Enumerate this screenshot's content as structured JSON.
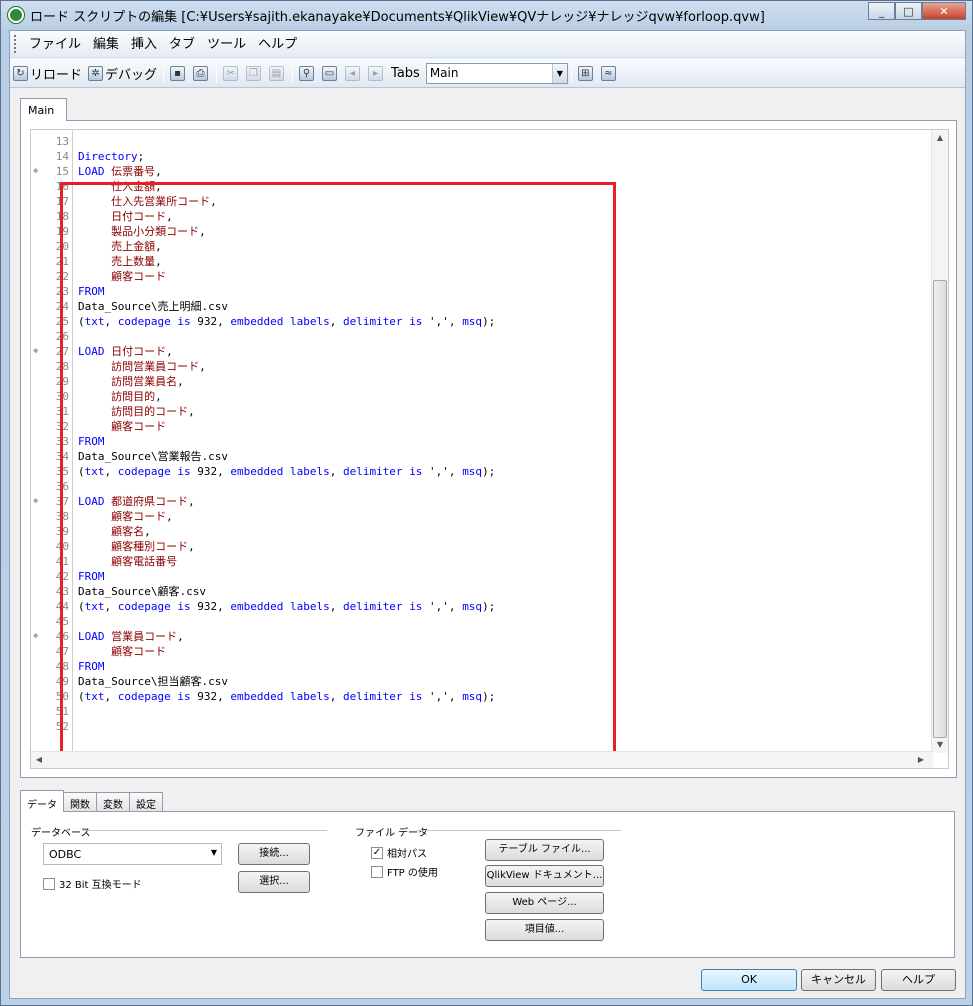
{
  "window": {
    "title": "ロード スクリプトの編集 [C:¥Users¥sajith.ekanayake¥Documents¥QlikView¥QVナレッジ¥ナレッジqvw¥forloop.qvw]",
    "min": "_",
    "max": "□",
    "close": "✕"
  },
  "menu": [
    "ファイル",
    "編集",
    "挿入",
    "タブ",
    "ツール",
    "ヘルプ"
  ],
  "toolbar": {
    "reload": "リロード",
    "debug": "デバッグ",
    "tabs_label": "Tabs",
    "tabs_value": "Main"
  },
  "editor_tab": "Main",
  "code": [
    {
      "n": "13",
      "t": []
    },
    {
      "n": "14",
      "t": [
        [
          "kw",
          "Directory"
        ],
        [
          "plain",
          ";"
        ]
      ]
    },
    {
      "n": "15",
      "t": [
        [
          "kw",
          "LOAD "
        ],
        [
          "fld",
          "伝票番号"
        ],
        [
          "plain",
          ","
        ]
      ]
    },
    {
      "n": "16",
      "t": [
        [
          "plain",
          "     "
        ],
        [
          "fld",
          "仕入金額"
        ],
        [
          "plain",
          ","
        ]
      ]
    },
    {
      "n": "17",
      "t": [
        [
          "plain",
          "     "
        ],
        [
          "fld",
          "仕入先営業所コード"
        ],
        [
          "plain",
          ","
        ]
      ]
    },
    {
      "n": "18",
      "t": [
        [
          "plain",
          "     "
        ],
        [
          "fld",
          "日付コード"
        ],
        [
          "plain",
          ","
        ]
      ]
    },
    {
      "n": "19",
      "t": [
        [
          "plain",
          "     "
        ],
        [
          "fld",
          "製品小分類コード"
        ],
        [
          "plain",
          ","
        ]
      ]
    },
    {
      "n": "20",
      "t": [
        [
          "plain",
          "     "
        ],
        [
          "fld",
          "売上金額"
        ],
        [
          "plain",
          ","
        ]
      ]
    },
    {
      "n": "21",
      "t": [
        [
          "plain",
          "     "
        ],
        [
          "fld",
          "売上数量"
        ],
        [
          "plain",
          ","
        ]
      ]
    },
    {
      "n": "22",
      "t": [
        [
          "plain",
          "     "
        ],
        [
          "fld",
          "顧客コード"
        ]
      ]
    },
    {
      "n": "23",
      "t": [
        [
          "kw",
          "FROM"
        ]
      ]
    },
    {
      "n": "24",
      "t": [
        [
          "plain",
          "Data_Source\\売上明細.csv"
        ]
      ]
    },
    {
      "n": "25",
      "t": [
        [
          "plain",
          "("
        ],
        [
          "kw",
          "txt"
        ],
        [
          "plain",
          ", "
        ],
        [
          "kw",
          "codepage"
        ],
        [
          "plain",
          " "
        ],
        [
          "kw",
          "is"
        ],
        [
          "plain",
          " 932, "
        ],
        [
          "kw",
          "embedded labels"
        ],
        [
          "plain",
          ", "
        ],
        [
          "kw",
          "delimiter"
        ],
        [
          "plain",
          " "
        ],
        [
          "kw",
          "is"
        ],
        [
          "plain",
          " ',', "
        ],
        [
          "kw",
          "msq"
        ],
        [
          "plain",
          ");"
        ]
      ]
    },
    {
      "n": "26",
      "t": []
    },
    {
      "n": "27",
      "t": [
        [
          "kw",
          "LOAD "
        ],
        [
          "fld",
          "日付コード"
        ],
        [
          "plain",
          ","
        ]
      ]
    },
    {
      "n": "28",
      "t": [
        [
          "plain",
          "     "
        ],
        [
          "fld",
          "訪問営業員コード"
        ],
        [
          "plain",
          ","
        ]
      ]
    },
    {
      "n": "29",
      "t": [
        [
          "plain",
          "     "
        ],
        [
          "fld",
          "訪問営業員名"
        ],
        [
          "plain",
          ","
        ]
      ]
    },
    {
      "n": "30",
      "t": [
        [
          "plain",
          "     "
        ],
        [
          "fld",
          "訪問目的"
        ],
        [
          "plain",
          ","
        ]
      ]
    },
    {
      "n": "31",
      "t": [
        [
          "plain",
          "     "
        ],
        [
          "fld",
          "訪問目的コード"
        ],
        [
          "plain",
          ","
        ]
      ]
    },
    {
      "n": "32",
      "t": [
        [
          "plain",
          "     "
        ],
        [
          "fld",
          "顧客コード"
        ]
      ]
    },
    {
      "n": "33",
      "t": [
        [
          "kw",
          "FROM"
        ]
      ]
    },
    {
      "n": "34",
      "t": [
        [
          "plain",
          "Data_Source\\営業報告.csv"
        ]
      ]
    },
    {
      "n": "35",
      "t": [
        [
          "plain",
          "("
        ],
        [
          "kw",
          "txt"
        ],
        [
          "plain",
          ", "
        ],
        [
          "kw",
          "codepage"
        ],
        [
          "plain",
          " "
        ],
        [
          "kw",
          "is"
        ],
        [
          "plain",
          " 932, "
        ],
        [
          "kw",
          "embedded labels"
        ],
        [
          "plain",
          ", "
        ],
        [
          "kw",
          "delimiter"
        ],
        [
          "plain",
          " "
        ],
        [
          "kw",
          "is"
        ],
        [
          "plain",
          " ',', "
        ],
        [
          "kw",
          "msq"
        ],
        [
          "plain",
          ");"
        ]
      ]
    },
    {
      "n": "36",
      "t": []
    },
    {
      "n": "37",
      "t": [
        [
          "kw",
          "LOAD "
        ],
        [
          "fld",
          "都道府県コード"
        ],
        [
          "plain",
          ","
        ]
      ]
    },
    {
      "n": "38",
      "t": [
        [
          "plain",
          "     "
        ],
        [
          "fld",
          "顧客コード"
        ],
        [
          "plain",
          ","
        ]
      ]
    },
    {
      "n": "39",
      "t": [
        [
          "plain",
          "     "
        ],
        [
          "fld",
          "顧客名"
        ],
        [
          "plain",
          ","
        ]
      ]
    },
    {
      "n": "40",
      "t": [
        [
          "plain",
          "     "
        ],
        [
          "fld",
          "顧客種別コード"
        ],
        [
          "plain",
          ","
        ]
      ]
    },
    {
      "n": "41",
      "t": [
        [
          "plain",
          "     "
        ],
        [
          "fld",
          "顧客電話番号"
        ]
      ]
    },
    {
      "n": "42",
      "t": [
        [
          "kw",
          "FROM"
        ]
      ]
    },
    {
      "n": "43",
      "t": [
        [
          "plain",
          "Data_Source\\顧客.csv"
        ]
      ]
    },
    {
      "n": "44",
      "t": [
        [
          "plain",
          "("
        ],
        [
          "kw",
          "txt"
        ],
        [
          "plain",
          ", "
        ],
        [
          "kw",
          "codepage"
        ],
        [
          "plain",
          " "
        ],
        [
          "kw",
          "is"
        ],
        [
          "plain",
          " 932, "
        ],
        [
          "kw",
          "embedded labels"
        ],
        [
          "plain",
          ", "
        ],
        [
          "kw",
          "delimiter"
        ],
        [
          "plain",
          " "
        ],
        [
          "kw",
          "is"
        ],
        [
          "plain",
          " ',', "
        ],
        [
          "kw",
          "msq"
        ],
        [
          "plain",
          ");"
        ]
      ]
    },
    {
      "n": "45",
      "t": []
    },
    {
      "n": "46",
      "t": [
        [
          "kw",
          "LOAD "
        ],
        [
          "fld",
          "営業員コード"
        ],
        [
          "plain",
          ","
        ]
      ]
    },
    {
      "n": "47",
      "t": [
        [
          "plain",
          "     "
        ],
        [
          "fld",
          "顧客コード"
        ]
      ]
    },
    {
      "n": "48",
      "t": [
        [
          "kw",
          "FROM"
        ]
      ]
    },
    {
      "n": "49",
      "t": [
        [
          "plain",
          "Data_Source\\担当顧客.csv"
        ]
      ]
    },
    {
      "n": "50",
      "t": [
        [
          "plain",
          "("
        ],
        [
          "kw",
          "txt"
        ],
        [
          "plain",
          ", "
        ],
        [
          "kw",
          "codepage"
        ],
        [
          "plain",
          " "
        ],
        [
          "kw",
          "is"
        ],
        [
          "plain",
          " 932, "
        ],
        [
          "kw",
          "embedded labels"
        ],
        [
          "plain",
          ", "
        ],
        [
          "kw",
          "delimiter"
        ],
        [
          "plain",
          " "
        ],
        [
          "kw",
          "is"
        ],
        [
          "plain",
          " ',', "
        ],
        [
          "kw",
          "msq"
        ],
        [
          "plain",
          ");"
        ]
      ]
    },
    {
      "n": "51",
      "t": []
    },
    {
      "n": "52",
      "t": []
    }
  ],
  "lower_tabs": [
    "データ",
    "関数",
    "変数",
    "設定"
  ],
  "database": {
    "group": "データベース",
    "value": "ODBC",
    "connect": "接続...",
    "select": "選択...",
    "bit32": "32 Bit 互換モード"
  },
  "filedata": {
    "group": "ファイル データ",
    "relative": "相対パス",
    "ftp": "FTP の使用",
    "table_file": "テーブル ファイル...",
    "qv_doc": "QlikView ドキュメント...",
    "web": "Web ページ...",
    "field": "項目値..."
  },
  "dialog": {
    "ok": "OK",
    "cancel": "キャンセル",
    "help": "ヘルプ"
  },
  "colors": {
    "keyword": "#0000ff",
    "field": "#8b0000",
    "highlight": "#e81f26"
  }
}
